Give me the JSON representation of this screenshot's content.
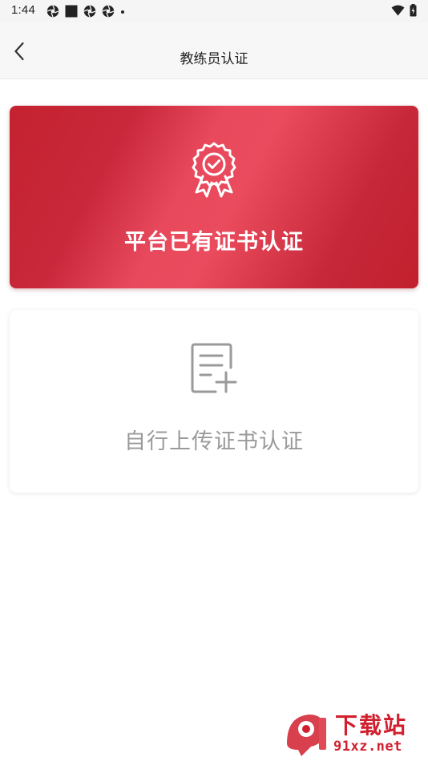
{
  "status_bar": {
    "time": "1:44"
  },
  "nav": {
    "title": "教练员认证"
  },
  "cards": {
    "platform": {
      "label": "平台已有证书认证",
      "icon": "certificate-badge-icon"
    },
    "upload": {
      "label": "自行上传证书认证",
      "icon": "document-add-icon"
    }
  },
  "watermark": {
    "top": "下载站",
    "bottom": "91xz.net"
  },
  "colors": {
    "accent_red": "#c8283a",
    "card_gradient_light": "#ea4b5d",
    "muted_gray": "#9a9a9a",
    "watermark_red": "#d11f2e"
  }
}
